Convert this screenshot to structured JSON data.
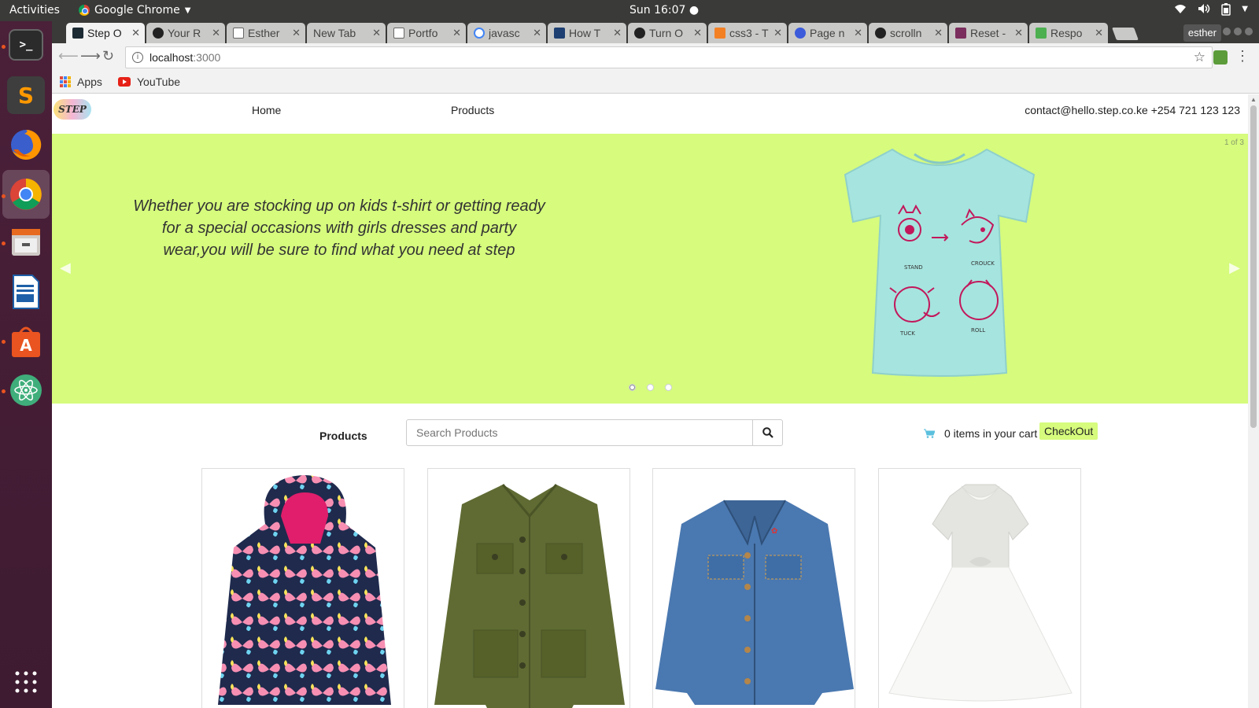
{
  "os": {
    "activities": "Activities",
    "app_name": "Google Chrome",
    "clock": "Sun 16:07 ●"
  },
  "browser": {
    "tabs": [
      {
        "label": "Step O",
        "active": true
      },
      {
        "label": "Your R"
      },
      {
        "label": "Esther"
      },
      {
        "label": "New Tab"
      },
      {
        "label": "Portfo"
      },
      {
        "label": "javasc"
      },
      {
        "label": "How T"
      },
      {
        "label": "Turn O"
      },
      {
        "label": "css3 - T"
      },
      {
        "label": "Page n"
      },
      {
        "label": "scrolln"
      },
      {
        "label": "Reset -"
      },
      {
        "label": "Respo"
      }
    ],
    "profile": "esther",
    "url_host": "localhost",
    "url_port": ":3000",
    "bookmarks": {
      "apps": "Apps",
      "youtube": "YouTube"
    }
  },
  "site": {
    "logo": "STEP",
    "nav": {
      "home": "Home",
      "products": "Products"
    },
    "contact": "contact@hello.step.co.ke +254 721 123 123",
    "hero": {
      "text": "Whether you are stocking up on kids t-shirt or getting ready for a special occasions with girls dresses and party wear,you will be sure to find what you need at step",
      "counter": "1 of 3",
      "active_slide": 1,
      "slide_count": 3,
      "background": "#d6fb7d"
    },
    "products_bar": {
      "label": "Products",
      "search_placeholder": "Search Products",
      "cart_text": "0 items in your cart",
      "checkout": "CheckOut"
    },
    "products": [
      {
        "name": "butterfly-raincoat"
      },
      {
        "name": "olive-utility-jacket"
      },
      {
        "name": "denim-jacket"
      },
      {
        "name": "white-party-dress"
      }
    ]
  }
}
